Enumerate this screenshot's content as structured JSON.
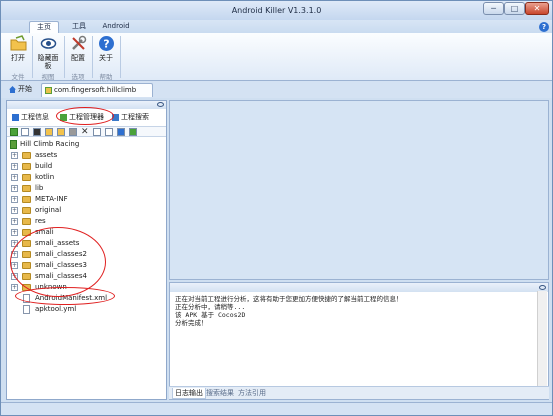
{
  "window": {
    "title": "Android Killer V1.3.1.0",
    "min_label": "─",
    "max_label": "□",
    "close_label": "✕"
  },
  "ribbon_tabs": [
    "主页",
    "工具",
    "Android"
  ],
  "help_label": "?",
  "ribbon": {
    "buttons": [
      {
        "label": "打开",
        "icon": "open-folder-icon"
      },
      {
        "label": "隐藏面板",
        "icon": "eye-icon"
      },
      {
        "label": "配置",
        "icon": "tools-icon"
      },
      {
        "label": "关于",
        "icon": "help-icon"
      }
    ],
    "groups": [
      "文件",
      "视图",
      "选项",
      "帮助"
    ]
  },
  "doc_tabs": [
    {
      "label": "开始",
      "icon": "home-icon"
    },
    {
      "label": "com.fingersoft.hillclimb",
      "icon": "project-icon"
    }
  ],
  "left_panel": {
    "tabs": [
      {
        "label": "工程信息",
        "icon": "info-icon"
      },
      {
        "label": "工程管理器",
        "icon": "manager-icon"
      },
      {
        "label": "工程搜索",
        "icon": "search-icon"
      }
    ],
    "root": "Hill Climb Racing",
    "items": [
      {
        "label": "assets",
        "type": "folder"
      },
      {
        "label": "build",
        "type": "folder"
      },
      {
        "label": "kotlin",
        "type": "folder"
      },
      {
        "label": "lib",
        "type": "folder"
      },
      {
        "label": "META-INF",
        "type": "folder"
      },
      {
        "label": "original",
        "type": "folder"
      },
      {
        "label": "res",
        "type": "folder"
      },
      {
        "label": "smali",
        "type": "folder"
      },
      {
        "label": "smali_assets",
        "type": "folder"
      },
      {
        "label": "smali_classes2",
        "type": "folder"
      },
      {
        "label": "smali_classes3",
        "type": "folder"
      },
      {
        "label": "smali_classes4",
        "type": "folder"
      },
      {
        "label": "unknown",
        "type": "folder"
      },
      {
        "label": "AndroidManifest.xml",
        "type": "file"
      },
      {
        "label": "apktool.yml",
        "type": "file"
      }
    ]
  },
  "log": {
    "lines": [
      "正在对当前工程进行分析，这将有助于您更加方便快捷的了解当前工程的信息！",
      "正在分析中，请稍等...",
      "该 APK 基于 Cocos2D",
      "分析完成！"
    ]
  },
  "bottom_tabs": [
    "日志输出",
    "搜索结果",
    "方法引用"
  ],
  "colors": {
    "annotation": "#e02020",
    "accent": "#2d6fd0"
  }
}
